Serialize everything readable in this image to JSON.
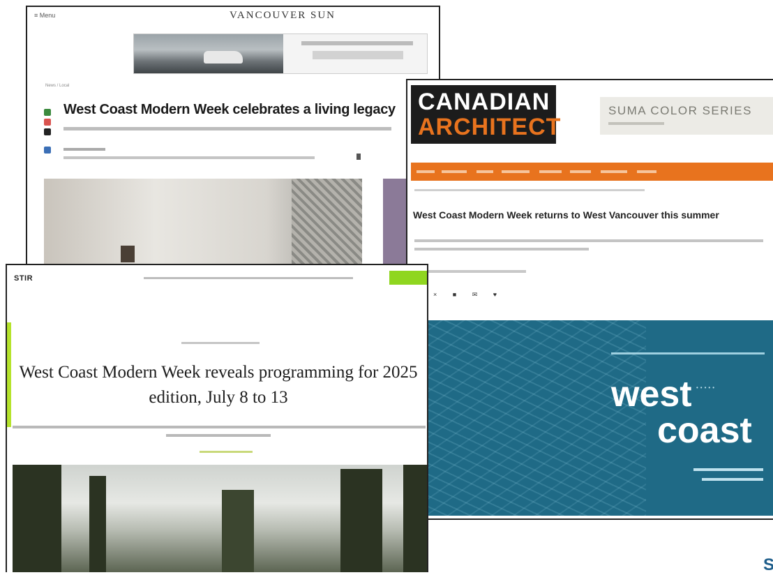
{
  "vancouver_sun": {
    "menu_label": "≡  Menu",
    "masthead": "VANCOUVER SUN",
    "breadcrumb": "News / Local",
    "headline": "West Coast Modern Week celebrates a living legacy",
    "share_colors": [
      "#3b8a3e",
      "#d9534f",
      "#222222",
      "#3b6fb6"
    ]
  },
  "canadian_architect": {
    "logo_line1": "CANADIAN",
    "logo_line2": "ARCHITECT",
    "banner_ad": "SUMA COLOR SERIES",
    "headline": "West Coast Modern Week returns to West Vancouver this summer",
    "share_icons": "f × ■ ✉ ♥",
    "hero_word1": "west",
    "hero_word2": "coast",
    "hero_dots": "•••••",
    "accent": "#e8731e",
    "hero_color": "#1f6a86"
  },
  "stir_article": {
    "logo": "STIR",
    "headline": "West Coast Modern Week reveals programming for 2025 edition, July 8 to 13",
    "accent": "#8fd61f"
  },
  "corner_glyph": "S"
}
